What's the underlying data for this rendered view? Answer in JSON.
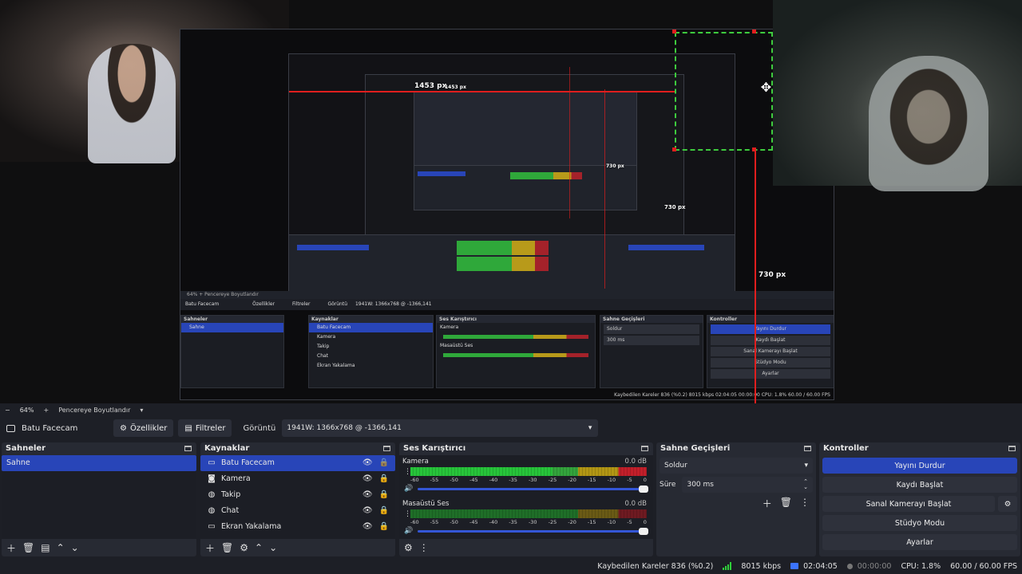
{
  "preview": {
    "guide_top": "1453 px",
    "guide_top_small": "1453 px",
    "guide_mid": "730 px",
    "guide_mid_small": "730 px",
    "guide_right": "730 px",
    "nested_status": "Kaybedilen Kareler 836 (%0.2)   8015 kbps   02:04:05   00:00:00   CPU: 1.8%   60.00 / 60.00 FPS",
    "nested_zoom": "64%   +   Pencereye Boyutlandır"
  },
  "zoom": {
    "minus": "−",
    "level": "64%",
    "plus": "+",
    "fit_label": "Pencereye Boyutlandır",
    "caret": "▾"
  },
  "context": {
    "source_name": "Batu Facecam",
    "properties_label": "Özellikler",
    "filters_label": "Filtreler",
    "display_label": "Görüntü",
    "display_value": "1941W: 1366x768 @ -1366,141"
  },
  "scenes": {
    "title": "Sahneler",
    "items": [
      "Sahne"
    ]
  },
  "sources": {
    "title": "Kaynaklar",
    "items": [
      {
        "label": "Batu Facecam",
        "icon": "monitor-icon"
      },
      {
        "label": "Kamera",
        "icon": "camera-icon"
      },
      {
        "label": "Takip",
        "icon": "globe-icon"
      },
      {
        "label": "Chat",
        "icon": "globe-icon"
      },
      {
        "label": "Ekran Yakalama",
        "icon": "monitor-icon"
      }
    ]
  },
  "mixer": {
    "title": "Ses Karıştırıcı",
    "channels": [
      {
        "name": "Kamera",
        "db": "0.0 dB",
        "level": 0.92
      },
      {
        "name": "Masaüstü Ses",
        "db": "0.0 dB",
        "level": 0.75
      }
    ],
    "ticks": [
      "-60",
      "-55",
      "-50",
      "-45",
      "-40",
      "-35",
      "-30",
      "-25",
      "-20",
      "-15",
      "-10",
      "-5",
      "0"
    ]
  },
  "transitions": {
    "title": "Sahne Geçişleri",
    "type": "Soldur",
    "duration_label": "Süre",
    "duration_value": "300 ms"
  },
  "controls": {
    "title": "Kontroller",
    "stop_stream": "Yayını Durdur",
    "start_record": "Kaydı Başlat",
    "virtual_cam": "Sanal Kamerayı Başlat",
    "studio_mode": "Stüdyo Modu",
    "settings": "Ayarlar"
  },
  "status": {
    "dropped": "Kaybedilen Kareler 836 (%0.2)",
    "bitrate": "8015 kbps",
    "stream_time": "02:04:05",
    "record_time": "00:00:00",
    "cpu": "CPU: 1.8%",
    "fps": "60.00 / 60.00 FPS"
  },
  "colors": {
    "accent": "#2845b8",
    "guide_red": "#e01e1e",
    "selection_green": "#3ecb3e",
    "panel": "#272a33"
  }
}
